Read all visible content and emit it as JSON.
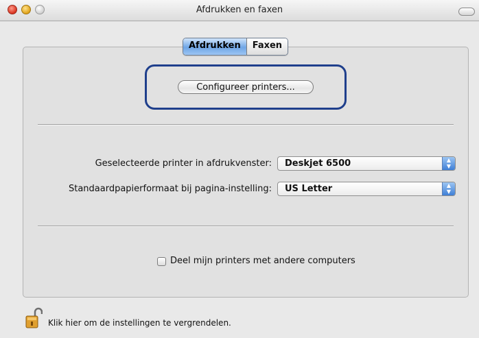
{
  "window": {
    "title": "Afdrukken en faxen"
  },
  "tabs": [
    {
      "label": "Afdrukken",
      "active": true
    },
    {
      "label": "Faxen",
      "active": false
    }
  ],
  "configure_button": {
    "label": "Configureer printers..."
  },
  "settings": {
    "selected_printer": {
      "label": "Geselecteerde printer in afdrukvenster:",
      "value": "Deskjet 6500"
    },
    "paper_size": {
      "label": "Standaardpapierformaat bij pagina-instelling:",
      "value": "US Letter"
    }
  },
  "share": {
    "label": "Deel mijn printers met andere computers",
    "checked": false
  },
  "lock": {
    "label": "Klik hier om de instellingen te vergrendelen.",
    "icon": "unlocked-padlock-icon"
  },
  "colors": {
    "highlight_box": "#1f3f8c",
    "active_tab": "#6fa6e6",
    "popup_arrow": "#3f7fd6"
  }
}
